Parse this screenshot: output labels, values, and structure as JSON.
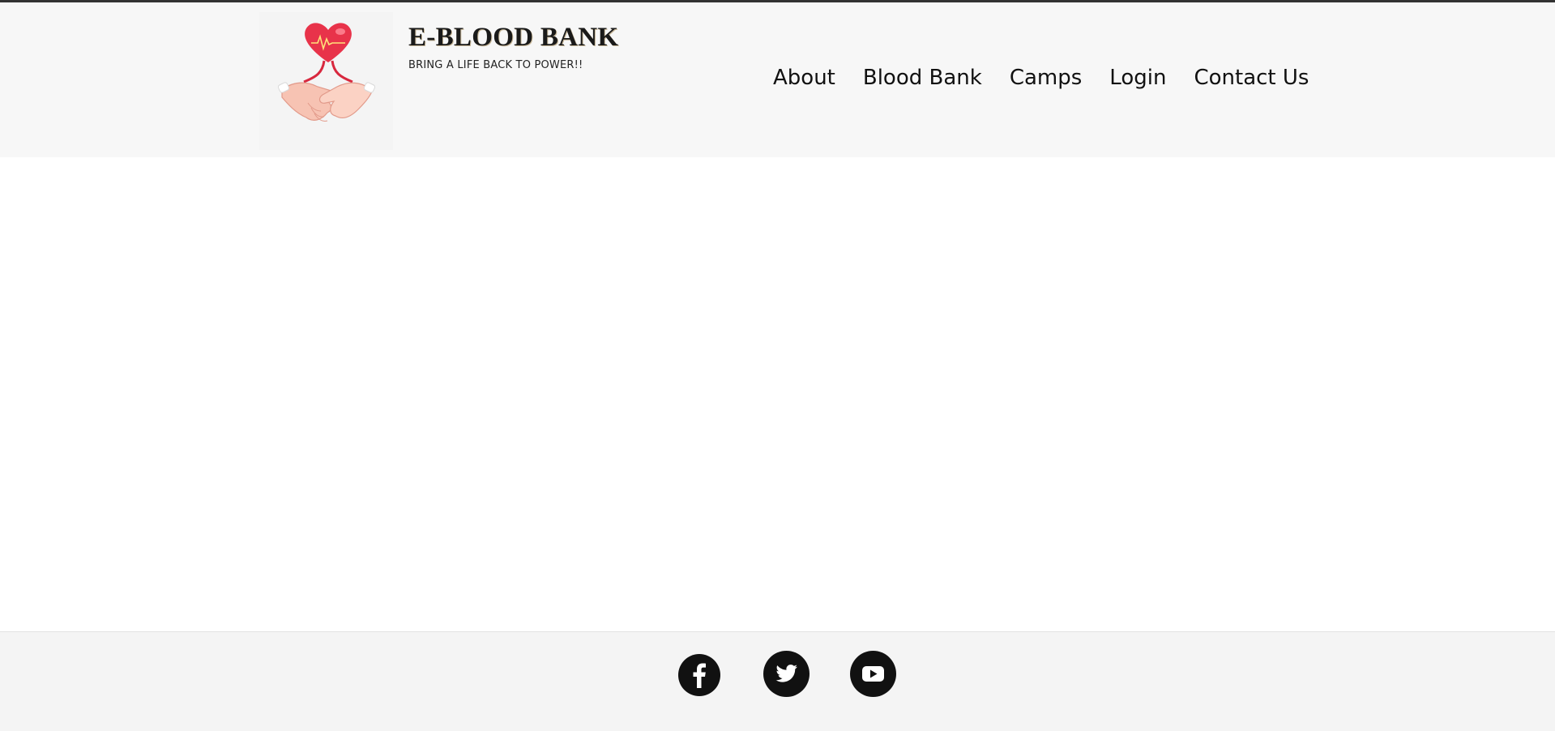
{
  "header": {
    "brand_title": "E-BLOOD BANK",
    "tagline": "BRING A LIFE BACK TO POWER!!",
    "logo_icon": "heart-handshake-logo",
    "accent_color": "#e8334a"
  },
  "nav": {
    "items": [
      {
        "label": "About"
      },
      {
        "label": "Blood Bank"
      },
      {
        "label": "Camps"
      },
      {
        "label": "Login"
      },
      {
        "label": "Contact Us"
      }
    ]
  },
  "footer": {
    "social": [
      {
        "icon": "facebook-icon"
      },
      {
        "icon": "twitter-icon"
      },
      {
        "icon": "youtube-icon"
      }
    ]
  }
}
